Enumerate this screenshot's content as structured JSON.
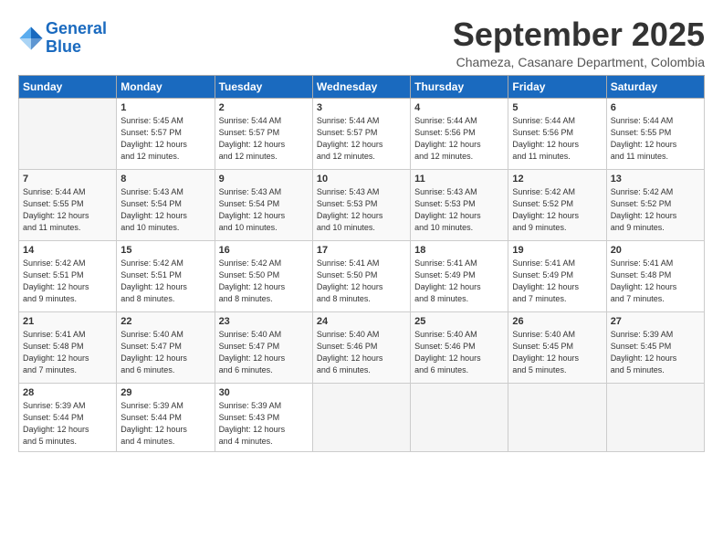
{
  "logo": {
    "line1": "General",
    "line2": "Blue"
  },
  "title": "September 2025",
  "subtitle": "Chameza, Casanare Department, Colombia",
  "weekdays": [
    "Sunday",
    "Monday",
    "Tuesday",
    "Wednesday",
    "Thursday",
    "Friday",
    "Saturday"
  ],
  "weeks": [
    [
      {
        "day": "",
        "info": ""
      },
      {
        "day": "1",
        "info": "Sunrise: 5:45 AM\nSunset: 5:57 PM\nDaylight: 12 hours\nand 12 minutes."
      },
      {
        "day": "2",
        "info": "Sunrise: 5:44 AM\nSunset: 5:57 PM\nDaylight: 12 hours\nand 12 minutes."
      },
      {
        "day": "3",
        "info": "Sunrise: 5:44 AM\nSunset: 5:57 PM\nDaylight: 12 hours\nand 12 minutes."
      },
      {
        "day": "4",
        "info": "Sunrise: 5:44 AM\nSunset: 5:56 PM\nDaylight: 12 hours\nand 12 minutes."
      },
      {
        "day": "5",
        "info": "Sunrise: 5:44 AM\nSunset: 5:56 PM\nDaylight: 12 hours\nand 11 minutes."
      },
      {
        "day": "6",
        "info": "Sunrise: 5:44 AM\nSunset: 5:55 PM\nDaylight: 12 hours\nand 11 minutes."
      }
    ],
    [
      {
        "day": "7",
        "info": "Sunrise: 5:44 AM\nSunset: 5:55 PM\nDaylight: 12 hours\nand 11 minutes."
      },
      {
        "day": "8",
        "info": "Sunrise: 5:43 AM\nSunset: 5:54 PM\nDaylight: 12 hours\nand 10 minutes."
      },
      {
        "day": "9",
        "info": "Sunrise: 5:43 AM\nSunset: 5:54 PM\nDaylight: 12 hours\nand 10 minutes."
      },
      {
        "day": "10",
        "info": "Sunrise: 5:43 AM\nSunset: 5:53 PM\nDaylight: 12 hours\nand 10 minutes."
      },
      {
        "day": "11",
        "info": "Sunrise: 5:43 AM\nSunset: 5:53 PM\nDaylight: 12 hours\nand 10 minutes."
      },
      {
        "day": "12",
        "info": "Sunrise: 5:42 AM\nSunset: 5:52 PM\nDaylight: 12 hours\nand 9 minutes."
      },
      {
        "day": "13",
        "info": "Sunrise: 5:42 AM\nSunset: 5:52 PM\nDaylight: 12 hours\nand 9 minutes."
      }
    ],
    [
      {
        "day": "14",
        "info": "Sunrise: 5:42 AM\nSunset: 5:51 PM\nDaylight: 12 hours\nand 9 minutes."
      },
      {
        "day": "15",
        "info": "Sunrise: 5:42 AM\nSunset: 5:51 PM\nDaylight: 12 hours\nand 8 minutes."
      },
      {
        "day": "16",
        "info": "Sunrise: 5:42 AM\nSunset: 5:50 PM\nDaylight: 12 hours\nand 8 minutes."
      },
      {
        "day": "17",
        "info": "Sunrise: 5:41 AM\nSunset: 5:50 PM\nDaylight: 12 hours\nand 8 minutes."
      },
      {
        "day": "18",
        "info": "Sunrise: 5:41 AM\nSunset: 5:49 PM\nDaylight: 12 hours\nand 8 minutes."
      },
      {
        "day": "19",
        "info": "Sunrise: 5:41 AM\nSunset: 5:49 PM\nDaylight: 12 hours\nand 7 minutes."
      },
      {
        "day": "20",
        "info": "Sunrise: 5:41 AM\nSunset: 5:48 PM\nDaylight: 12 hours\nand 7 minutes."
      }
    ],
    [
      {
        "day": "21",
        "info": "Sunrise: 5:41 AM\nSunset: 5:48 PM\nDaylight: 12 hours\nand 7 minutes."
      },
      {
        "day": "22",
        "info": "Sunrise: 5:40 AM\nSunset: 5:47 PM\nDaylight: 12 hours\nand 6 minutes."
      },
      {
        "day": "23",
        "info": "Sunrise: 5:40 AM\nSunset: 5:47 PM\nDaylight: 12 hours\nand 6 minutes."
      },
      {
        "day": "24",
        "info": "Sunrise: 5:40 AM\nSunset: 5:46 PM\nDaylight: 12 hours\nand 6 minutes."
      },
      {
        "day": "25",
        "info": "Sunrise: 5:40 AM\nSunset: 5:46 PM\nDaylight: 12 hours\nand 6 minutes."
      },
      {
        "day": "26",
        "info": "Sunrise: 5:40 AM\nSunset: 5:45 PM\nDaylight: 12 hours\nand 5 minutes."
      },
      {
        "day": "27",
        "info": "Sunrise: 5:39 AM\nSunset: 5:45 PM\nDaylight: 12 hours\nand 5 minutes."
      }
    ],
    [
      {
        "day": "28",
        "info": "Sunrise: 5:39 AM\nSunset: 5:44 PM\nDaylight: 12 hours\nand 5 minutes."
      },
      {
        "day": "29",
        "info": "Sunrise: 5:39 AM\nSunset: 5:44 PM\nDaylight: 12 hours\nand 4 minutes."
      },
      {
        "day": "30",
        "info": "Sunrise: 5:39 AM\nSunset: 5:43 PM\nDaylight: 12 hours\nand 4 minutes."
      },
      {
        "day": "",
        "info": ""
      },
      {
        "day": "",
        "info": ""
      },
      {
        "day": "",
        "info": ""
      },
      {
        "day": "",
        "info": ""
      }
    ]
  ]
}
